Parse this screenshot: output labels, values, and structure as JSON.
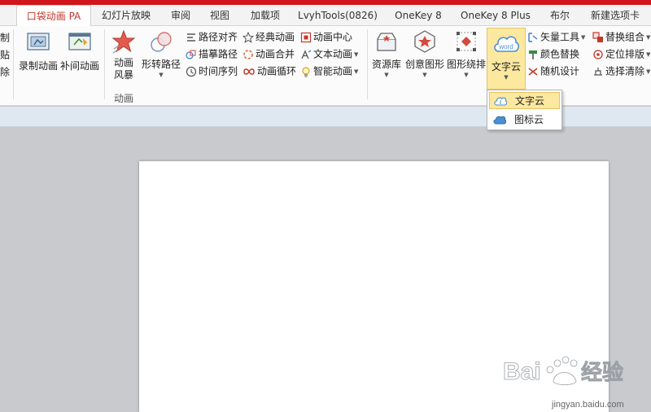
{
  "tabs": [
    {
      "label": "口袋动画 PA",
      "active": true
    },
    {
      "label": "幻灯片放映"
    },
    {
      "label": "审阅"
    },
    {
      "label": "视图"
    },
    {
      "label": "加载项"
    },
    {
      "label": "LvyhTools(0826)"
    },
    {
      "label": "OneKey 8"
    },
    {
      "label": "OneKey 8 Plus"
    },
    {
      "label": "布尔"
    },
    {
      "label": "新建选项卡"
    }
  ],
  "ribbon": {
    "clipped": [
      "制",
      "贴",
      "除"
    ],
    "record_animation": "录制动画",
    "tween_animation": "补间动画",
    "anim_storm_1": "动画",
    "anim_storm_2": "风暴",
    "shape_path": "形转路径",
    "path_align": "路径对齐",
    "trace_path": "描摹路径",
    "timeline": "时间序列",
    "classic_anim": "经典动画",
    "merge_anim": "动画合并",
    "loop_anim": "动画循环",
    "anim_center": "动画中心",
    "text_anim": "文本动画",
    "smart_anim": "智能动画",
    "group_animation": "动画",
    "resource_lib": "资源库",
    "creative_shape": "创意图形",
    "shape_arrange": "图形绕排",
    "word_cloud": "文字云",
    "word_cloud_icon_text": "word",
    "vector_tools": "矢量工具",
    "color_replace": "颜色替换",
    "random_design": "随机设计",
    "replace_combine": "替换组合",
    "position_layout": "定位排版",
    "select_clear": "选择清除"
  },
  "dropdown": {
    "items": [
      {
        "label": "文字云",
        "highlighted": true
      },
      {
        "label": "图标云"
      }
    ]
  },
  "watermark": {
    "brand": "Bai",
    "brand2": "经验",
    "url": "jingyan.baidu.com"
  },
  "colors": {
    "accent_red": "#d0151b",
    "highlight": "#fde8a0",
    "ribbon_bg": "#fbfbfb",
    "workspace": "#c8cacd"
  }
}
